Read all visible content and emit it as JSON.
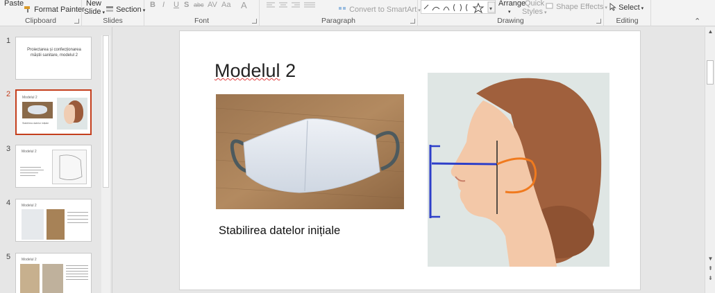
{
  "ribbon": {
    "clipboard": {
      "paste": "Paste",
      "format_painter": "Format Painter",
      "label": "Clipboard"
    },
    "slides": {
      "new_slide_line1": "New",
      "new_slide_line2": "Slide",
      "section": "Section",
      "label": "Slides"
    },
    "font": {
      "bold": "B",
      "italic": "I",
      "underline": "U",
      "shadow": "S",
      "strike": "abc",
      "spacing": "AV",
      "case": "Aa",
      "color": "A",
      "label": "Font"
    },
    "paragraph": {
      "smartart": "Convert to SmartArt",
      "label": "Paragraph"
    },
    "drawing": {
      "arrange": "Arrange",
      "quick_styles_line1": "Quick",
      "quick_styles_line2": "Styles",
      "shape_effects": "Shape Effects",
      "label": "Drawing"
    },
    "editing": {
      "select": "Select",
      "label": "Editing"
    }
  },
  "thumbnails": [
    {
      "num": "1",
      "title": "Proiectarea și confecționarea măștii sanitare, modelul 2"
    },
    {
      "num": "2",
      "title": "Modelul 2",
      "sub": "Stabilirea datelor inițiale"
    },
    {
      "num": "3",
      "title": "Modelul 2"
    },
    {
      "num": "4",
      "title": "Modelul 2"
    },
    {
      "num": "5",
      "title": "Modelul 2"
    }
  ],
  "slide": {
    "title_prefix": "Modelul",
    "title_suffix": " 2",
    "caption": "Stabilirea datelor inițiale"
  },
  "colors": {
    "accent_selected": "#c43e1c",
    "measure_blue": "#2d3fc9",
    "measure_orange": "#f07a1e"
  }
}
